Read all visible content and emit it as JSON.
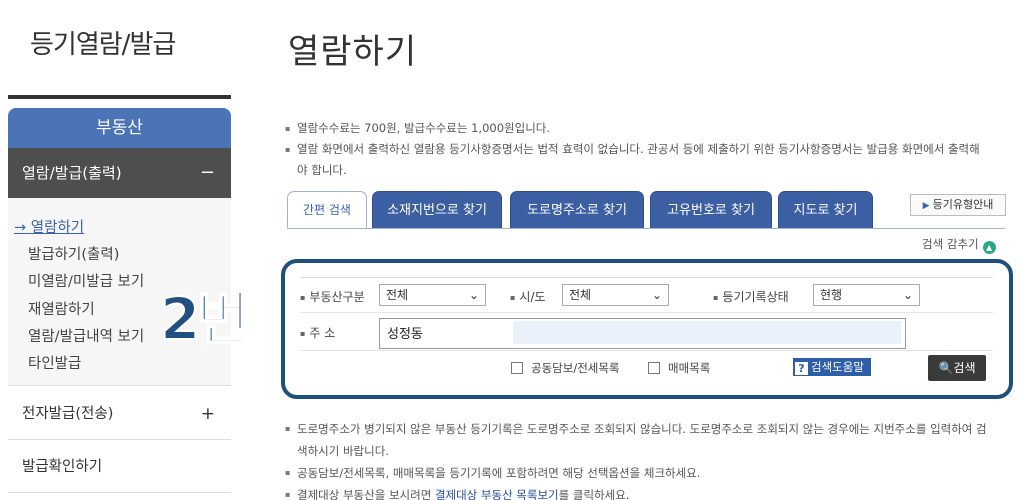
{
  "sidebar": {
    "title": "등기열람/발급",
    "section_header": "부동산",
    "open_item": "열람/발급(출력)",
    "open_item_toggle": "−",
    "sub_items": [
      "열람하기",
      "발급하기(출력)",
      "미열람/미발급 보기",
      "재열람하기",
      "열람/발급내역 보기",
      "타인발급"
    ],
    "active_marker": "→",
    "items": [
      {
        "label": "전자발급(전송)",
        "toggle": "+"
      },
      {
        "label": "발급확인하기",
        "toggle": ""
      }
    ]
  },
  "overlay_label": "2번",
  "main": {
    "title": "열람하기",
    "notes": [
      "열람수수료는 700원, 발급수수료는 1,000원입니다.",
      "열람 화면에서 출력하신 열람용 등기사항증명서는 법적 효력이 없습니다. 관공서 등에 제출하기 위한 등기사항증명서는 발급용 화면에서 출력해야 합니다."
    ],
    "tabs": [
      "간편 검색",
      "소재지번으로 찾기",
      "도로명주소로 찾기",
      "고유번호로 찾기",
      "지도로 찾기"
    ],
    "guide_button": "등기유형안내",
    "hide_search": "검색 감추기",
    "form": {
      "property_type_label": "부동산구분",
      "property_type_value": "전체",
      "city_label": "시/도",
      "city_value": "전체",
      "record_status_label": "등기기록상태",
      "record_status_value": "현행",
      "address_label": "주 소",
      "address_value": "성정동",
      "check_joint": "공동담보/전세목록",
      "check_sale": "매매목록",
      "help_button": "검색도움말",
      "search_button": "검색"
    },
    "bottom_notes": [
      "도로명주소가 병기되지 않은 부동산 등기기록은 도로명주소로 조회되지 않습니다. 도로명주소로 조회되지 않는 경우에는 지번주소를 입력하여 검색하시기 바랍니다.",
      "공동담보/전세목록, 매매목록을 등기기록에 포함하려면 해당 선택옵션을 체크하세요."
    ],
    "payment_note_prefix": "결제대상 부동산을 보시려면 ",
    "payment_note_link": "결제대상 부동산 목록보기",
    "payment_note_suffix": "를 클릭하세요."
  }
}
